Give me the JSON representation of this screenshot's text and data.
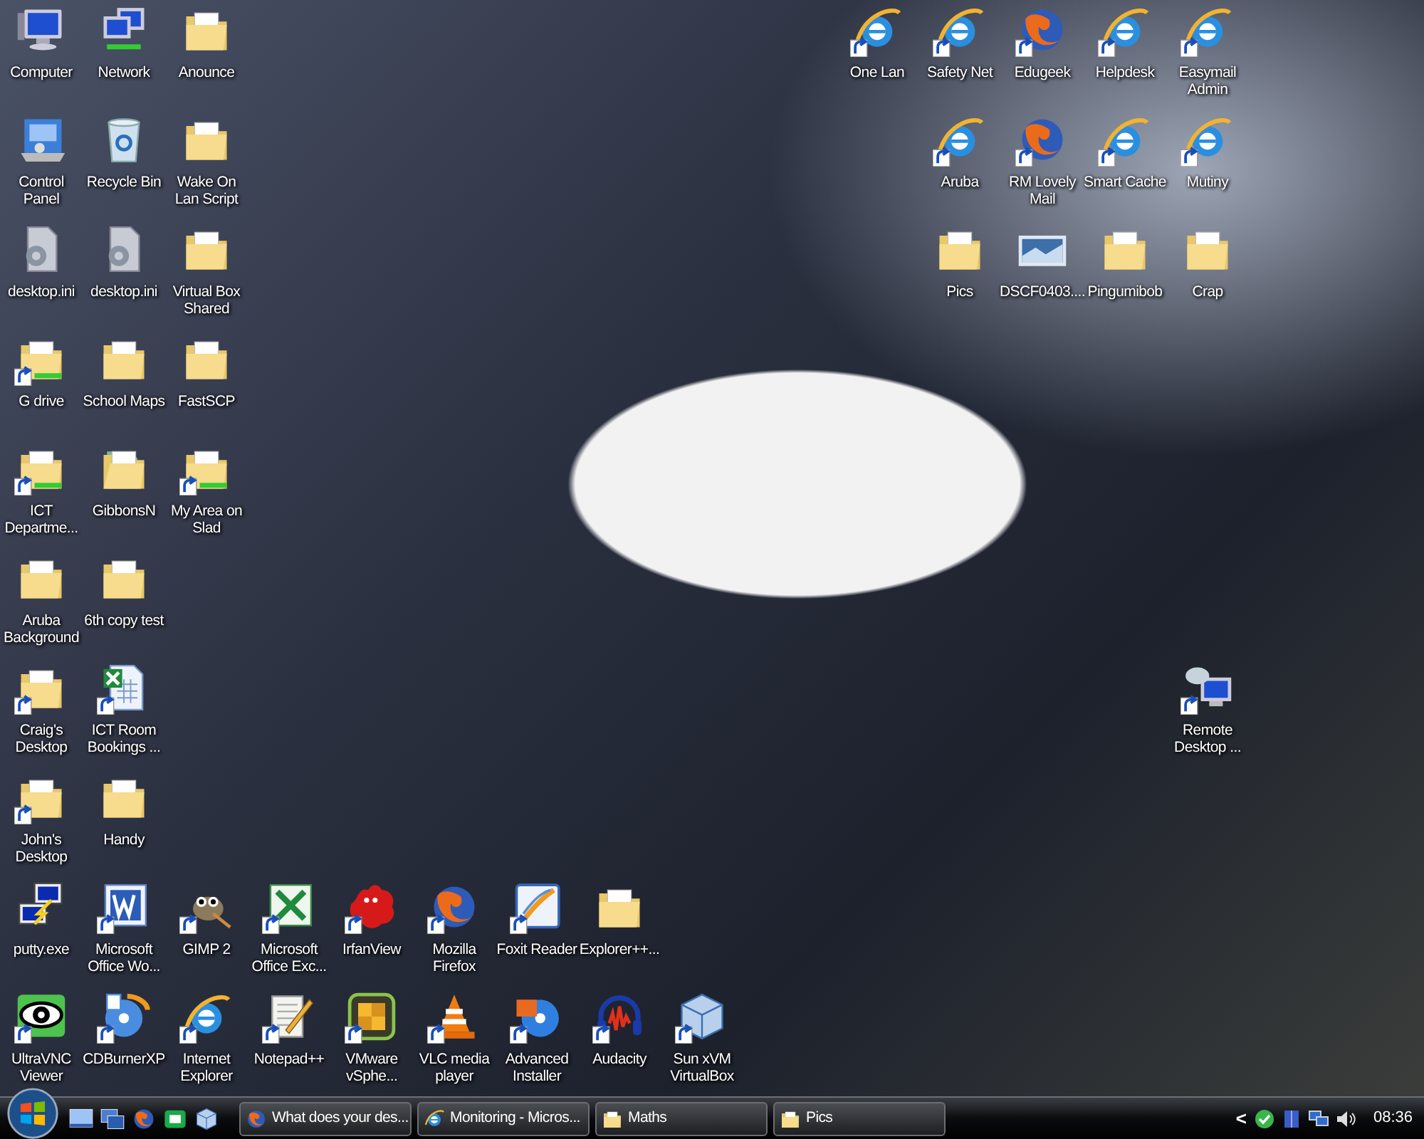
{
  "desktop": {
    "rows": [
      {
        "left": [
          {
            "label": "Computer",
            "kind": "computer",
            "shortcut": false
          },
          {
            "label": "Network",
            "kind": "network",
            "shortcut": false
          },
          {
            "label": "Anounce",
            "kind": "folder",
            "shortcut": false
          }
        ],
        "right": [
          {
            "label": "One Lan",
            "kind": "ie",
            "shortcut": true
          },
          {
            "label": "Safety Net",
            "kind": "ie",
            "shortcut": true
          },
          {
            "label": "Edugeek",
            "kind": "firefox",
            "shortcut": true
          },
          {
            "label": "Helpdesk",
            "kind": "ie",
            "shortcut": true
          },
          {
            "label": "Easymail Admin",
            "kind": "ie",
            "shortcut": true
          }
        ]
      },
      {
        "left": [
          {
            "label": "Control Panel",
            "kind": "control-panel",
            "shortcut": false
          },
          {
            "label": "Recycle Bin",
            "kind": "recycle-bin",
            "shortcut": false
          },
          {
            "label": "Wake On Lan Script",
            "kind": "folder",
            "shortcut": false
          }
        ],
        "right": [
          {
            "label": "Aruba",
            "kind": "ie",
            "shortcut": true
          },
          {
            "label": "RM Lovely Mail",
            "kind": "firefox",
            "shortcut": true
          },
          {
            "label": "Smart Cache",
            "kind": "ie",
            "shortcut": true
          },
          {
            "label": "Mutiny",
            "kind": "ie",
            "shortcut": true
          }
        ]
      },
      {
        "left": [
          {
            "label": "desktop.ini",
            "kind": "settings-file",
            "shortcut": false
          },
          {
            "label": "desktop.ini",
            "kind": "settings-file",
            "shortcut": false
          },
          {
            "label": "Virtual Box Shared",
            "kind": "folder",
            "shortcut": false
          }
        ],
        "right": [
          {
            "label": "Pics",
            "kind": "folder",
            "shortcut": false
          },
          {
            "label": "DSCF0403....",
            "kind": "image",
            "shortcut": false
          },
          {
            "label": "Pingumibob",
            "kind": "folder",
            "shortcut": false
          },
          {
            "label": "Crap",
            "kind": "folder",
            "shortcut": false
          }
        ]
      },
      {
        "left": [
          {
            "label": "G drive",
            "kind": "network-folder",
            "shortcut": true
          },
          {
            "label": "School Maps",
            "kind": "folder",
            "shortcut": false
          },
          {
            "label": "FastSCP",
            "kind": "folder",
            "shortcut": false
          }
        ],
        "right": []
      },
      {
        "left": [
          {
            "label": "ICT Departme...",
            "kind": "network-folder",
            "shortcut": true
          },
          {
            "label": "GibbonsN",
            "kind": "user-folder",
            "shortcut": false
          },
          {
            "label": "My Area on Slad",
            "kind": "network-folder",
            "shortcut": true
          }
        ],
        "right": []
      },
      {
        "left": [
          {
            "label": "Aruba Background",
            "kind": "folder",
            "shortcut": false
          },
          {
            "label": "6th copy test",
            "kind": "folder",
            "shortcut": false
          }
        ],
        "right": []
      },
      {
        "left": [
          {
            "label": "Craig's Desktop",
            "kind": "folder",
            "shortcut": true
          },
          {
            "label": "ICT Room Bookings ...",
            "kind": "excel-file",
            "shortcut": true
          }
        ],
        "right": [
          {
            "label": "Remote Desktop ...",
            "kind": "remote-desktop",
            "shortcut": true
          }
        ]
      },
      {
        "left": [
          {
            "label": "John's Desktop",
            "kind": "folder",
            "shortcut": true
          },
          {
            "label": "Handy",
            "kind": "folder",
            "shortcut": false
          }
        ],
        "right": []
      },
      {
        "left": [
          {
            "label": "putty.exe",
            "kind": "putty",
            "shortcut": false
          },
          {
            "label": "Microsoft Office Wo...",
            "kind": "word",
            "shortcut": true
          },
          {
            "label": "GIMP 2",
            "kind": "gimp",
            "shortcut": true
          },
          {
            "label": "Microsoft Office Exc...",
            "kind": "excel",
            "shortcut": true
          },
          {
            "label": "IrfanView",
            "kind": "irfanview",
            "shortcut": true
          },
          {
            "label": "Mozilla Firefox",
            "kind": "firefox",
            "shortcut": true
          },
          {
            "label": "Foxit Reader",
            "kind": "foxit",
            "shortcut": true
          },
          {
            "label": "Explorer++...",
            "kind": "folder",
            "shortcut": false
          }
        ],
        "right": []
      },
      {
        "left": [
          {
            "label": "UltraVNC Viewer",
            "kind": "vnc",
            "shortcut": true
          },
          {
            "label": "CDBurnerXP",
            "kind": "cdburner",
            "shortcut": true
          },
          {
            "label": "Internet Explorer",
            "kind": "ie",
            "shortcut": true
          },
          {
            "label": "Notepad++",
            "kind": "notepad",
            "shortcut": true
          },
          {
            "label": "VMware vSphe...",
            "kind": "vmware",
            "shortcut": true
          },
          {
            "label": "VLC media player",
            "kind": "vlc",
            "shortcut": true
          },
          {
            "label": "Advanced Installer",
            "kind": "installer",
            "shortcut": true
          },
          {
            "label": "Audacity",
            "kind": "audacity",
            "shortcut": true
          },
          {
            "label": "Sun xVM VirtualBox",
            "kind": "virtualbox",
            "shortcut": true
          }
        ],
        "right": []
      }
    ]
  },
  "taskbar": {
    "quick_launch": [
      {
        "kind": "show-desktop"
      },
      {
        "kind": "switch-windows"
      },
      {
        "kind": "firefox"
      },
      {
        "kind": "green-app"
      },
      {
        "kind": "virtualbox"
      }
    ],
    "tasks": [
      {
        "label": "What does your des...",
        "kind": "firefox"
      },
      {
        "label": "Monitoring - Micros...",
        "kind": "ie"
      },
      {
        "label": "Maths",
        "kind": "folder"
      },
      {
        "label": "Pics",
        "kind": "folder"
      }
    ],
    "tray": {
      "chevron": "<",
      "icons": [
        {
          "kind": "shield"
        },
        {
          "kind": "book"
        },
        {
          "kind": "network"
        },
        {
          "kind": "volume"
        }
      ],
      "clock": "08:36"
    }
  }
}
